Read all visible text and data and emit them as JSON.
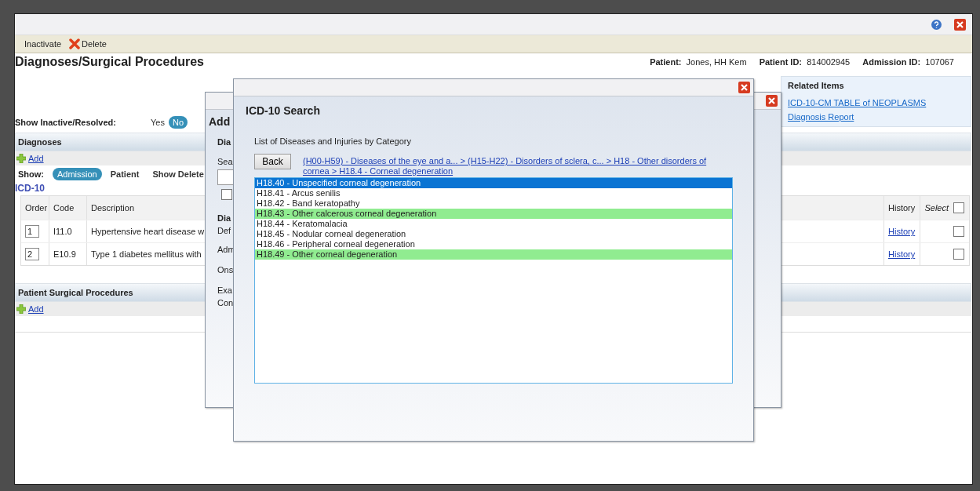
{
  "toolbar": [
    {
      "label": "Inactivate",
      "kind": "plain"
    },
    {
      "label": "Delete",
      "kind": "delete"
    }
  ],
  "page": {
    "title": "Diagnoses/Surgical Procedures",
    "patient_info": [
      {
        "label": "Patient:",
        "value": "Jones, HH Kem"
      },
      {
        "label": "Patient ID:",
        "value": "814002945"
      },
      {
        "label": "Admission ID:",
        "value": "107067"
      }
    ]
  },
  "related_items": {
    "title": "Related Items",
    "links": [
      "ICD-10-CM TABLE of NEOPLASMS",
      "Diagnosis Report"
    ]
  },
  "show_inactive": {
    "label": "Show Inactive/Resolved:",
    "options": [
      {
        "label": "Yes",
        "selected": false
      },
      {
        "label": "No",
        "selected": true
      }
    ]
  },
  "diagnoses": {
    "title": "Diagnoses",
    "add": "Add",
    "show_label": "Show:",
    "filters": [
      {
        "label": "Admission",
        "selected": true
      },
      {
        "label": "Patient",
        "selected": false
      },
      {
        "label": "Show Delete",
        "selected": false
      }
    ],
    "code_system": "ICD-10",
    "columns": [
      "Order",
      "Code",
      "Description",
      "History",
      "Select"
    ],
    "select_all_checked": false,
    "rows": [
      {
        "order": "1",
        "code": "I11.0",
        "description": "Hypertensive heart disease w",
        "history": "History",
        "checked": false
      },
      {
        "order": "2",
        "code": "E10.9",
        "description": "Type 1 diabetes mellitus with",
        "history": "History",
        "checked": false
      }
    ]
  },
  "surgical": {
    "title": "Patient Surgical Procedures",
    "add": "Add"
  },
  "add_dialog": {
    "title": "Add",
    "fields": [
      {
        "kind": "heading",
        "text": "Dia"
      },
      {
        "kind": "label",
        "text": "Sea"
      },
      {
        "kind": "input"
      },
      {
        "kind": "checkbox",
        "checked": false
      },
      {
        "kind": "heading",
        "text": "Dia"
      },
      {
        "kind": "label",
        "text": "Def"
      },
      {
        "kind": "label",
        "text": "Adm"
      },
      {
        "kind": "label",
        "text": "Ons"
      },
      {
        "kind": "label",
        "text": "Exa"
      },
      {
        "kind": "label",
        "text": "Con"
      }
    ]
  },
  "icd_dialog": {
    "title": "ICD-10 Search",
    "subtitle": "List of Diseases and Injuries by Category",
    "back": "Back",
    "breadcrumb": "(H00-H59) - Diseases of the eye and a... > (H15-H22) - Disorders of sclera, c... > H18 - Other disorders of cornea > H18.4 - Corneal degeneration",
    "items": [
      {
        "label": "H18.40 - Unspecified corneal degeneration",
        "selected": true,
        "highlighted": false
      },
      {
        "label": "H18.41 - Arcus senilis",
        "selected": false,
        "highlighted": false
      },
      {
        "label": "H18.42 - Band keratopathy",
        "selected": false,
        "highlighted": false
      },
      {
        "label": "H18.43 - Other calcerous corneal degeneration",
        "selected": false,
        "highlighted": true
      },
      {
        "label": "H18.44 - Keratomalacia",
        "selected": false,
        "highlighted": false
      },
      {
        "label": "H18.45 - Nodular corneal degeneration",
        "selected": false,
        "highlighted": false
      },
      {
        "label": "H18.46 - Peripheral corneal degeneration",
        "selected": false,
        "highlighted": false
      },
      {
        "label": "H18.49 - Other corneal degeneration",
        "selected": false,
        "highlighted": true
      }
    ]
  }
}
